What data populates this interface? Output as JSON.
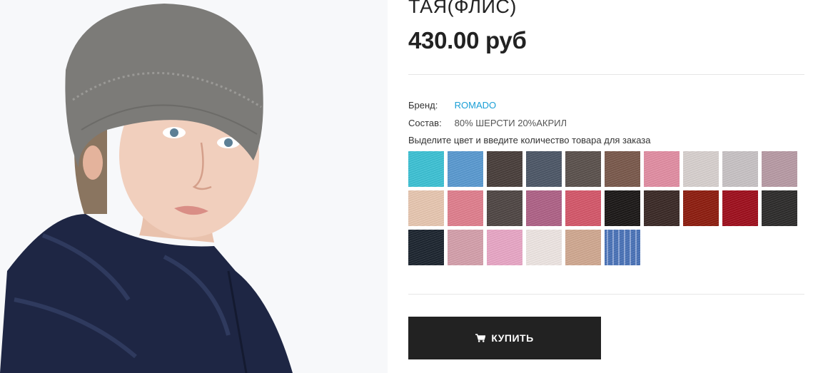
{
  "product": {
    "title": "ТАЯ(ФЛИС)",
    "price": "430.00 руб",
    "image": {
      "alt": ""
    }
  },
  "attributes": {
    "brand_label": "Бренд:",
    "brand_value": "ROMADO",
    "composition_label": "Состав:",
    "composition_value": "80% ШЕРСТИ 20%АКРИЛ"
  },
  "color_hint": "Выделите цвет и введите количество товара для заказа",
  "colors": [
    "#3ec3d6",
    "#5b9bd2",
    "#4a3f3c",
    "#4e5868",
    "#5c524e",
    "#7b5a4d",
    "#e38fa4",
    "#d9d2d0",
    "#c9c4c6",
    "#b99ca6",
    "#e9c8b2",
    "#e1808f",
    "#504745",
    "#b06388",
    "#d6596b",
    "#1c1918",
    "#3b2a27",
    "#8f1e10",
    "#a0101e",
    "#2e2d2c",
    "#1d2630",
    "#d6a1ad",
    "#eaa8c7",
    "#efe7e4",
    "#d2aa92",
    "#4a73b8"
  ],
  "buy_button": {
    "label": "КУПИТЬ",
    "icon": "cart-icon"
  }
}
